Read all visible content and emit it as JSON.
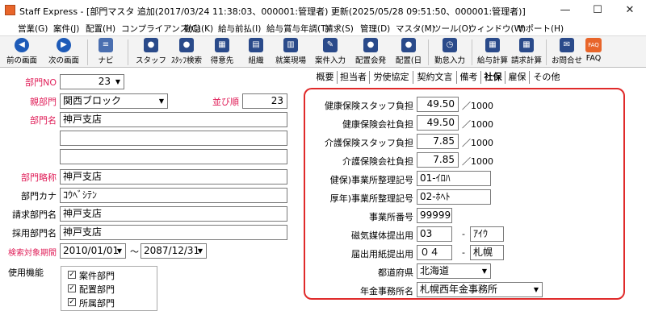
{
  "window": {
    "title": "Staff Express - [部門マスタ 追加(2017/03/24 11:38:03、000001:管理者) 更新(2025/05/28 09:51:50、000001:管理者)]",
    "minimize": "—",
    "maximize": "☐",
    "close": "✕"
  },
  "menu": [
    "営業(G)",
    "案件(J)",
    "配置(H)",
    "コンプライアンス(C)",
    "勤怠(K)",
    "給与前払(I)",
    "給与賞与年調(T)",
    "請求(S)",
    "管理(D)",
    "マスタ(M)",
    "ツール(O)",
    "ウィンドウ(W)",
    "サポート(H)"
  ],
  "toolbar": {
    "back": "前の画面",
    "next": "次の画面",
    "navi": "ナビ",
    "staff": "スタッフ",
    "staff_search": "ｽﾀｯﾌ検索",
    "client": "得意先",
    "org": "組織",
    "worksite": "就業現場",
    "project_input": "案件入力",
    "placement_memo": "配置会発",
    "placement_day": "配置(日",
    "attendance_input": "勤怠入力",
    "payroll_calc": "給与計算",
    "billing_calc": "請求計算",
    "contact": "お問合せ",
    "faq": "FAQ",
    "faq_icon": "FAQ"
  },
  "form": {
    "dept_no_label": "部門NO",
    "dept_no": "23",
    "parent_label": "親部門",
    "parent": "関西ブロック",
    "order_label": "並び順",
    "order": "23",
    "name_label": "部門名",
    "name": "神戸支店",
    "name2": "",
    "name3": "",
    "abbr_label": "部門略称",
    "abbr": "神戸支店",
    "kana_label": "部門カナ",
    "kana": "ｺｳﾍﾞｼﾃﾝ",
    "billing_label": "請求部門名",
    "billing": "神戸支店",
    "hiring_label": "採用部門名",
    "hiring": "神戸支店",
    "period_label": "検索対象期間",
    "period_from": "2010/01/01",
    "period_sep": "～",
    "period_to": "2087/12/31",
    "func_label": "使用機能",
    "funcs": [
      "案件部門",
      "配置部門",
      "所属部門"
    ]
  },
  "tabs": [
    "概要",
    "担当者",
    "労使協定",
    "契約文言",
    "備考",
    "社保",
    "雇保",
    "その他"
  ],
  "insurance": {
    "health_staff_label": "健康保険スタッフ負担",
    "health_staff": "49.50",
    "health_company_label": "健康保険会社負担",
    "health_company": "49.50",
    "care_staff_label": "介護保険スタッフ負担",
    "care_staff": "7.85",
    "care_company_label": "介護保険会社負担",
    "care_company": "7.85",
    "unit": "／1000",
    "health_office_label": "健保)事業所整理記号",
    "health_office": "01-ｲﾛﾊ",
    "pension_office_label": "厚年)事業所整理記号",
    "pension_office": "02-ﾎﾍﾄ",
    "office_no_label": "事業所番号",
    "office_no": "99999",
    "media_label": "磁気媒体提出用",
    "media_a": "03",
    "media_sep": "-",
    "media_b": "ｱｲｳ",
    "paper_label": "届出用紙提出用",
    "paper_a": "０４",
    "paper_sep": "-",
    "paper_b": "札幌",
    "pref_label": "都道府県",
    "pref": "北海道",
    "pension_office_name_label": "年金事務所名",
    "pension_office_name": "札幌西年金事務所"
  }
}
